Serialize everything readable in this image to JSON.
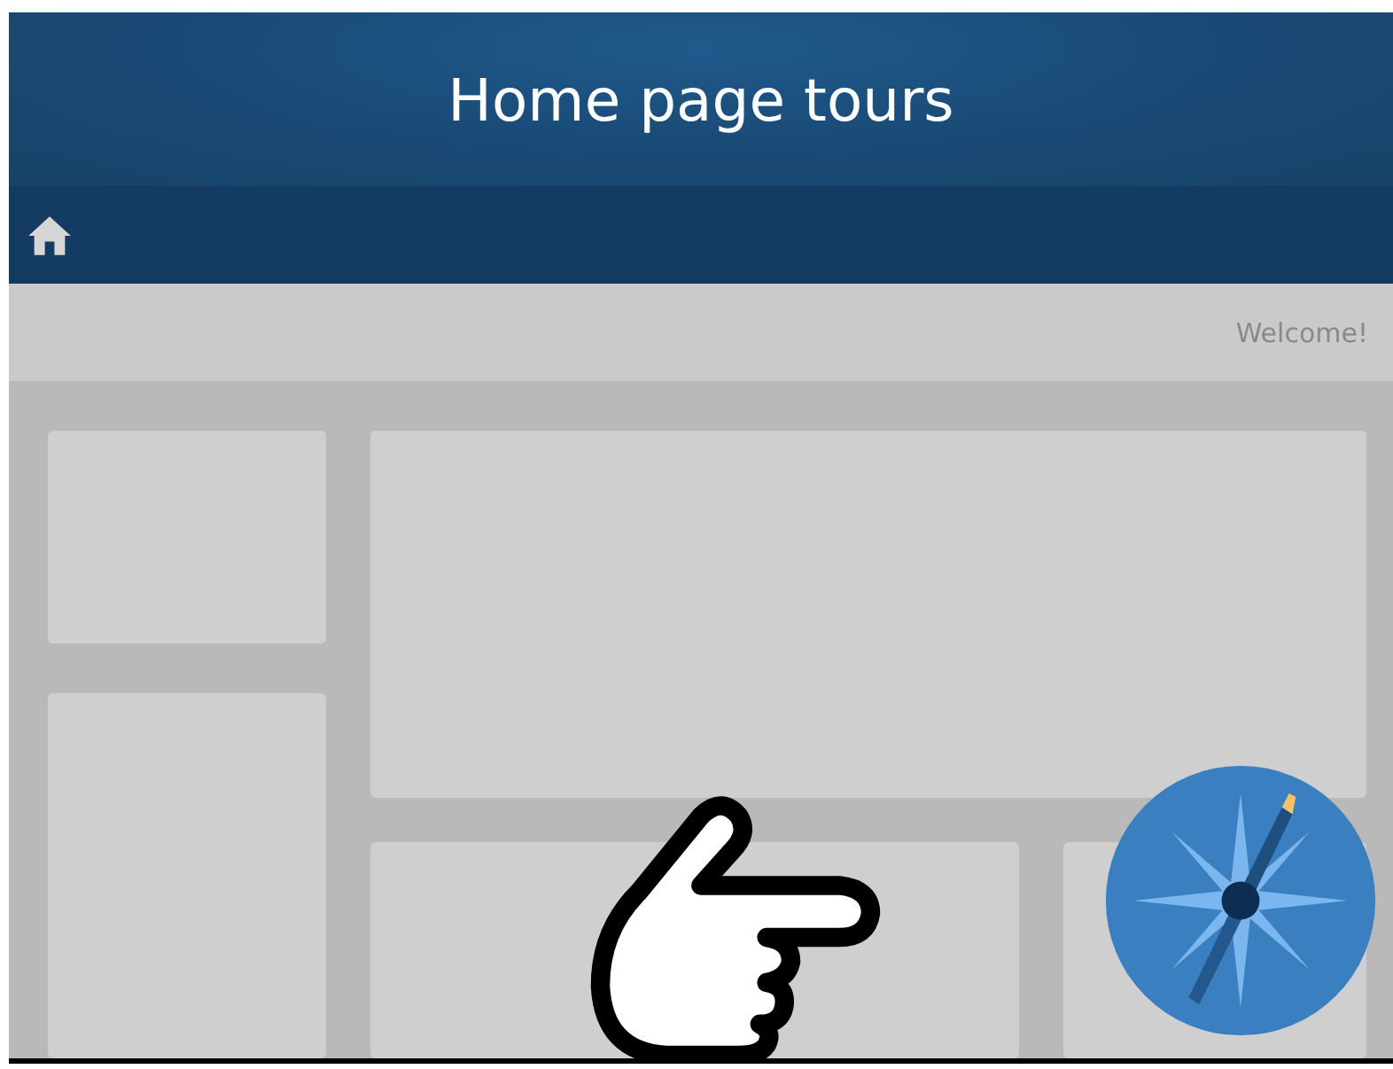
{
  "header": {
    "title": "Home page tours"
  },
  "info_bar": {
    "greeting": "Welcome!"
  }
}
